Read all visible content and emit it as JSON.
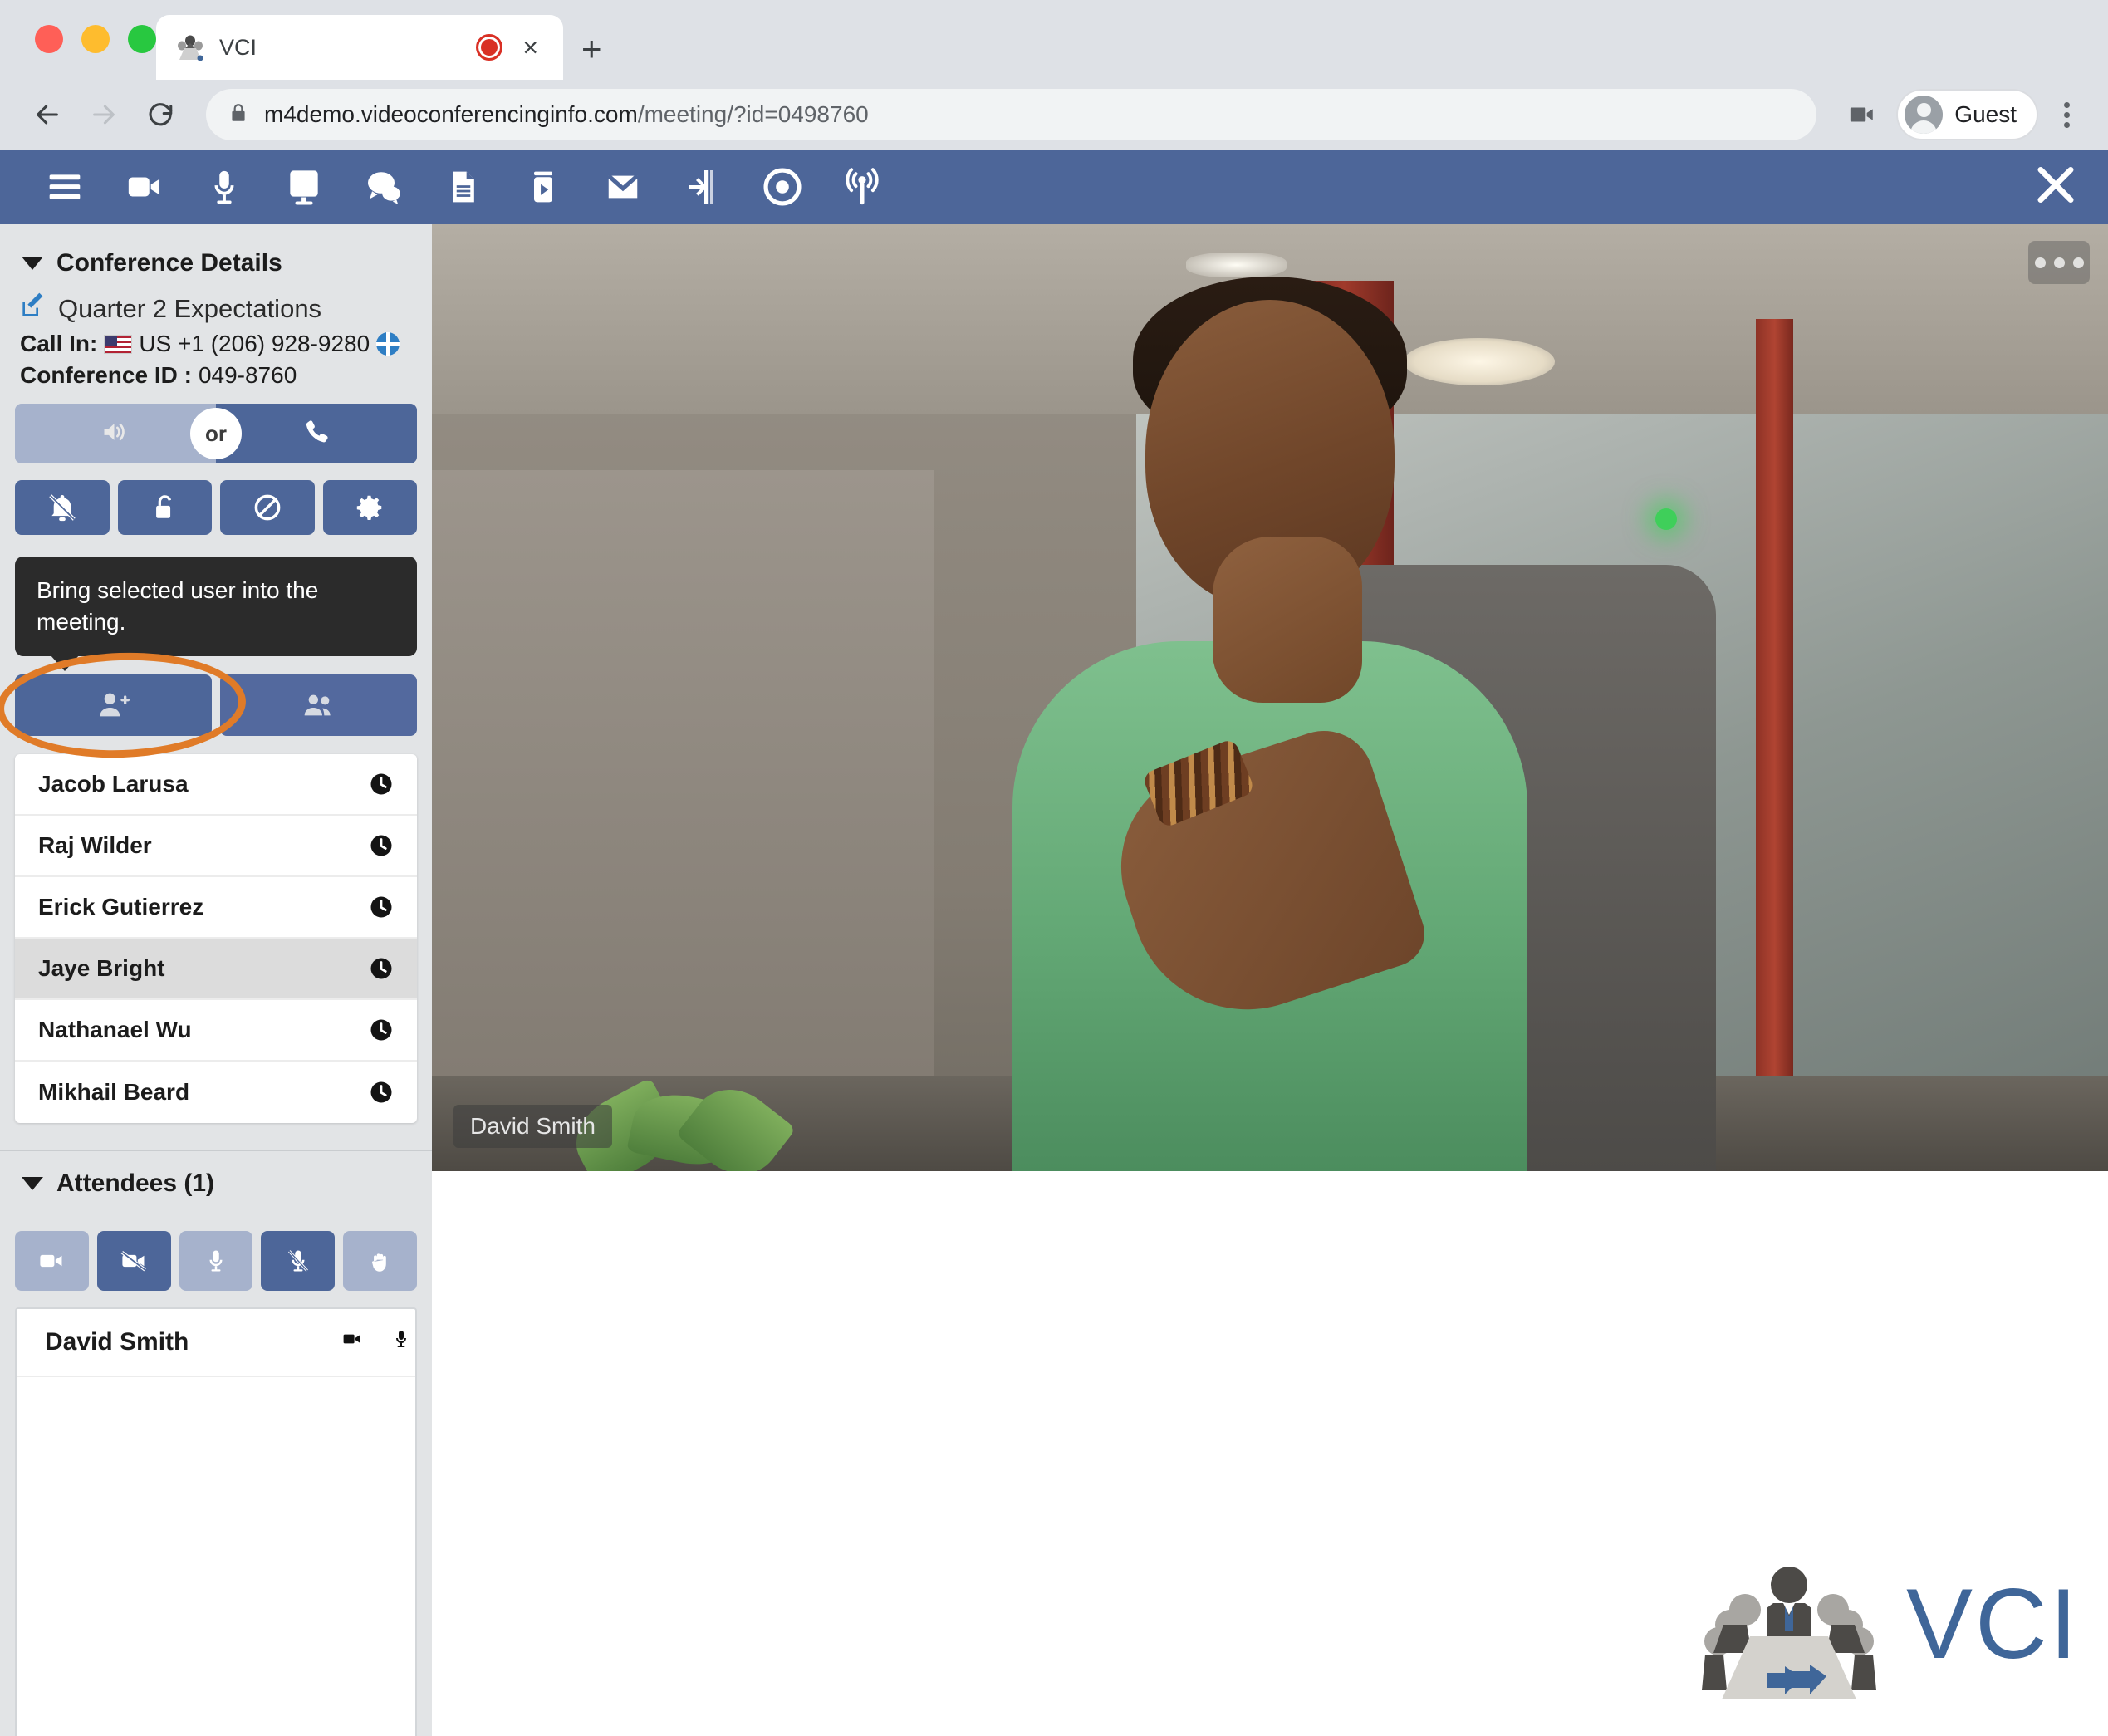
{
  "browser": {
    "tab": {
      "title": "VCI",
      "favicon": "vci-logo-icon",
      "recording_indicator": "recording-dot-icon",
      "close": "×"
    },
    "new_tab_label": "+",
    "nav": {
      "back": "←",
      "forward": "→",
      "reload": "⟳"
    },
    "omnibox": {
      "lock_icon": "lock-icon",
      "url_host": "m4demo.videoconferencinginfo.com",
      "url_path": "/meeting/?id=0498760",
      "full_url": "m4demo.videoconferencinginfo.com/meeting/?id=0498760"
    },
    "profile": {
      "name": "Guest",
      "avatar": "person-avatar-icon"
    },
    "camera_indicator": "camera-in-use-icon",
    "menu": "kebab-menu-icon"
  },
  "app_toolbar": {
    "items": [
      {
        "name": "hamburger-menu",
        "icon": "hamburger-icon"
      },
      {
        "name": "video-camera",
        "icon": "video-camera-icon"
      },
      {
        "name": "microphone",
        "icon": "microphone-icon"
      },
      {
        "name": "share-screen",
        "icon": "monitor-icon"
      },
      {
        "name": "chat",
        "icon": "chat-bubbles-icon"
      },
      {
        "name": "documents",
        "icon": "document-icon"
      },
      {
        "name": "media-player",
        "icon": "media-play-icon"
      },
      {
        "name": "mail",
        "icon": "envelope-icon"
      },
      {
        "name": "leave-room",
        "icon": "exit-door-icon"
      },
      {
        "name": "record",
        "icon": "record-circle-icon"
      },
      {
        "name": "broadcast",
        "icon": "broadcast-tower-icon"
      }
    ],
    "close_label": "✕"
  },
  "sidebar": {
    "conference_details": {
      "header": "Conference Details",
      "edit_icon": "edit-pencil-icon",
      "meeting_title": "Quarter 2 Expectations",
      "call_in_label": "Call In:",
      "call_in_flag": "us-flag-icon",
      "call_in_number": "US +1 (206) 928-9280",
      "globe_icon": "globe-icon",
      "conference_id_label": "Conference ID :",
      "conference_id": "049-8760"
    },
    "audio_toggle": {
      "speaker_icon": "speaker-icon",
      "or_label": "or",
      "phone_icon": "phone-handset-icon"
    },
    "action_buttons": [
      {
        "name": "mute-notifications",
        "icon": "bell-slash-icon"
      },
      {
        "name": "lock-meeting",
        "icon": "unlock-icon"
      },
      {
        "name": "block-participants",
        "icon": "no-entry-icon"
      },
      {
        "name": "meeting-settings",
        "icon": "gear-icon"
      }
    ],
    "tooltip": {
      "text": "Bring selected user into the meeting."
    },
    "user_actions": [
      {
        "name": "bring-user-into-meeting",
        "icon": "user-plus-icon",
        "highlighted": true
      },
      {
        "name": "manage-groups",
        "icon": "users-group-icon",
        "highlighted": false
      }
    ],
    "annotation": {
      "shape": "ellipse",
      "color": "#e07b28"
    },
    "user_list": [
      {
        "name": "Jacob Larusa",
        "status_icon": "clock-icon",
        "selected": false
      },
      {
        "name": "Raj Wilder",
        "status_icon": "clock-icon",
        "selected": false
      },
      {
        "name": "Erick Gutierrez",
        "status_icon": "clock-icon",
        "selected": false
      },
      {
        "name": "Jaye Bright",
        "status_icon": "clock-icon",
        "selected": true
      },
      {
        "name": "Nathanael Wu",
        "status_icon": "clock-icon",
        "selected": false
      },
      {
        "name": "Mikhail Beard",
        "status_icon": "clock-icon",
        "selected": false
      }
    ],
    "attendees": {
      "header": "Attendees (1)",
      "controls": [
        {
          "name": "enable-camera",
          "icon": "video-camera-icon",
          "state": "light"
        },
        {
          "name": "disable-camera",
          "icon": "video-camera-slash-icon",
          "state": "dark"
        },
        {
          "name": "enable-microphone",
          "icon": "microphone-icon",
          "state": "light"
        },
        {
          "name": "disable-microphone",
          "icon": "microphone-slash-icon",
          "state": "dark"
        },
        {
          "name": "raise-hand",
          "icon": "hand-icon",
          "state": "light"
        }
      ],
      "rows": [
        {
          "name": "David Smith",
          "camera_icon": "video-camera-icon",
          "microphone_icon": "microphone-icon"
        }
      ]
    }
  },
  "stage": {
    "video_label": "David Smith",
    "more_menu": "three-dots-icon",
    "watermark": {
      "text": "VCI",
      "logo": "conference-table-logo-icon"
    }
  },
  "colors": {
    "app_blue": "#4d6699",
    "button_light": "#a6b2cc",
    "annotation_orange": "#e07b28",
    "sidebar_bg": "#e2e4e6",
    "tooltip_bg": "#2b2b2b",
    "logo_blue": "#3f6699"
  }
}
